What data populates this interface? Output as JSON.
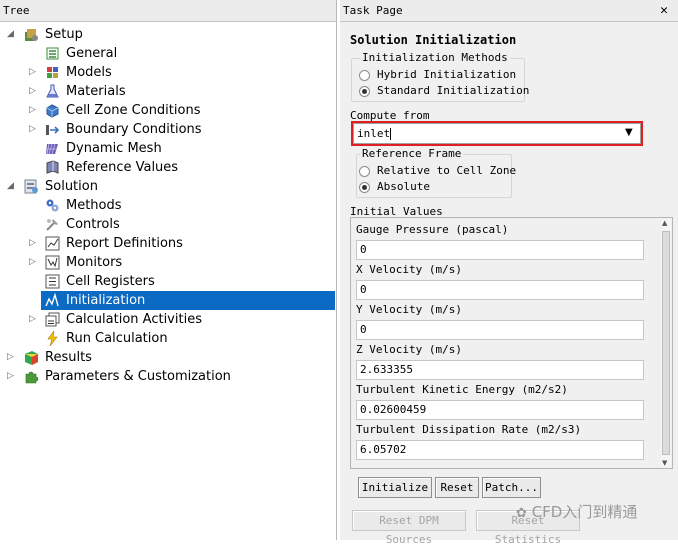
{
  "tree": {
    "header": "Tree",
    "items": [
      {
        "label": "Setup"
      },
      {
        "label": "General"
      },
      {
        "label": "Models"
      },
      {
        "label": "Materials"
      },
      {
        "label": "Cell Zone Conditions"
      },
      {
        "label": "Boundary Conditions"
      },
      {
        "label": "Dynamic Mesh"
      },
      {
        "label": "Reference Values"
      },
      {
        "label": "Solution"
      },
      {
        "label": "Methods"
      },
      {
        "label": "Controls"
      },
      {
        "label": "Report Definitions"
      },
      {
        "label": "Monitors"
      },
      {
        "label": "Cell Registers"
      },
      {
        "label": "Initialization"
      },
      {
        "label": "Calculation Activities"
      },
      {
        "label": "Run Calculation"
      },
      {
        "label": "Results"
      },
      {
        "label": "Parameters & Customization"
      }
    ]
  },
  "task": {
    "header": "Task Page",
    "close": "✕",
    "title": "Solution Initialization",
    "methods": {
      "label": "Initialization Methods",
      "hybrid": "Hybrid  Initialization",
      "standard": "Standard Initialization"
    },
    "compute": {
      "label": "Compute from",
      "value": "inlet"
    },
    "reference": {
      "label": "Reference Frame",
      "relative": "Relative to Cell Zone",
      "absolute": "Absolute"
    },
    "initial_values": {
      "label": "Initial Values",
      "fields": [
        {
          "label": "Gauge Pressure (pascal)",
          "value": "0"
        },
        {
          "label": "X Velocity (m/s)",
          "value": "0"
        },
        {
          "label": "Y Velocity (m/s)",
          "value": "0"
        },
        {
          "label": "Z Velocity (m/s)",
          "value": "2.633355"
        },
        {
          "label": "Turbulent Kinetic Energy (m2/s2)",
          "value": "0.02600459"
        },
        {
          "label": "Turbulent Dissipation Rate (m2/s3)",
          "value": "6.05702"
        }
      ]
    },
    "buttons": {
      "initialize": "Initialize",
      "reset": "Reset",
      "patch": "Patch...",
      "reset_dpm": "Reset DPM Sources",
      "reset_stats": "Reset Statistics"
    }
  },
  "watermark": "CFD入门到精通",
  "colors": {
    "selection": "#0b6bc4",
    "highlight_box": "#e02020"
  }
}
